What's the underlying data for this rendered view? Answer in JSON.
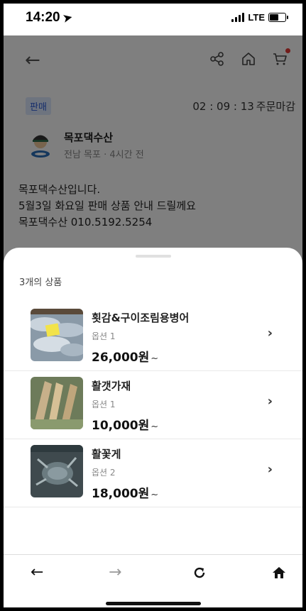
{
  "status_bar": {
    "time": "14:20",
    "network": "LTE"
  },
  "page": {
    "sale_badge": "판매",
    "deadline_time": "02 : 09 : 13",
    "deadline_label": "주문마감",
    "seller": {
      "name": "목포댁수산",
      "location_time": "전남 목포 · 4시간 전"
    },
    "description": [
      "목포댁수산입니다.",
      "5월3일 화요일 판매 상품 안내 드릴께요",
      "목포댁수산 010.5192.5254"
    ]
  },
  "sheet": {
    "count_label": "3개의 상품",
    "products": [
      {
        "name": "횟감&구이조림용병어",
        "option": "옵션 1",
        "price": "26,000원",
        "suffix": "~"
      },
      {
        "name": "활갯가재",
        "option": "옵션 1",
        "price": "10,000원",
        "suffix": "~"
      },
      {
        "name": "활꽃게",
        "option": "옵션 2",
        "price": "18,000원",
        "suffix": "~"
      }
    ]
  },
  "colors": {
    "accent_blue": "#2b5bd7",
    "badge_bg": "#dde8ff",
    "cart_dot": "#e53935",
    "overlay": "rgba(0,0,0,0.5)"
  }
}
